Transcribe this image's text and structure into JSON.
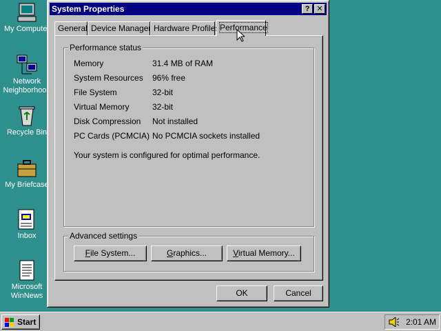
{
  "desktop": {
    "icons": [
      {
        "label": "My Computer",
        "icon": "computer-icon"
      },
      {
        "label": "Network\nNeighborhood",
        "icon": "network-icon"
      },
      {
        "label": "Recycle Bin",
        "icon": "recycle-bin-icon"
      },
      {
        "label": "My Briefcase",
        "icon": "briefcase-icon"
      },
      {
        "label": "Inbox",
        "icon": "inbox-icon"
      },
      {
        "label": "Microsoft\nWinNews",
        "icon": "newsletter-icon"
      }
    ]
  },
  "window": {
    "title": "System Properties",
    "help_btn": "?",
    "close_btn": "✕",
    "tabs": [
      {
        "label": "General"
      },
      {
        "label": "Device Manager"
      },
      {
        "label": "Hardware Profiles"
      },
      {
        "label": "Performance",
        "active": true
      }
    ],
    "status_group": {
      "title": "Performance status",
      "rows": [
        {
          "key": "Memory",
          "value": "31.4 MB of RAM"
        },
        {
          "key": "System Resources",
          "value": "96% free"
        },
        {
          "key": "File System",
          "value": "32-bit"
        },
        {
          "key": "Virtual Memory",
          "value": "32-bit"
        },
        {
          "key": "Disk Compression",
          "value": "Not installed"
        },
        {
          "key": "PC Cards (PCMCIA)",
          "value": "No PCMCIA sockets installed"
        }
      ],
      "message": "Your system is configured for optimal performance."
    },
    "advanced_group": {
      "title": "Advanced settings",
      "file_system": {
        "u": "F",
        "rest": "ile System..."
      },
      "graphics": {
        "u": "G",
        "rest": "raphics..."
      },
      "virtual_memory": {
        "u": "V",
        "rest": "irtual Memory..."
      }
    },
    "ok_label": "OK",
    "cancel_label": "Cancel"
  },
  "taskbar": {
    "start_label": "Start",
    "clock": "2:01 AM"
  },
  "colors": {
    "desktop": "#2f8f8c",
    "titlebar": "#000080",
    "face": "#c0c0c0"
  }
}
